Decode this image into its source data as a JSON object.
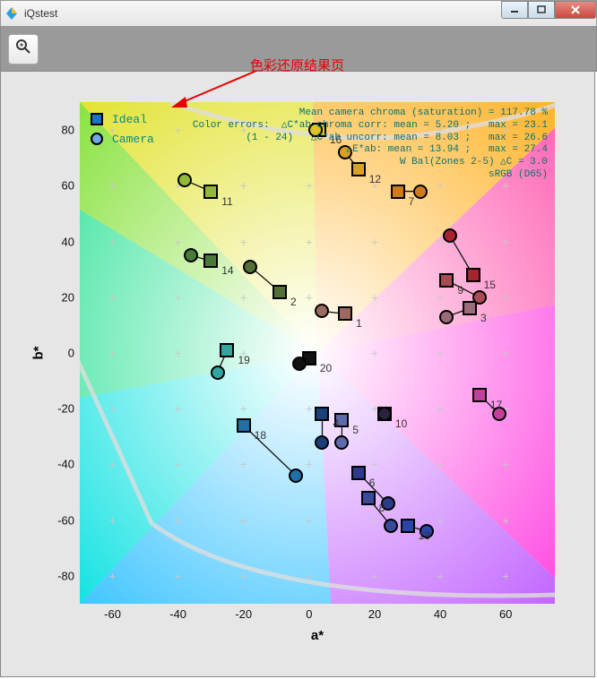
{
  "window": {
    "title": "iQstest"
  },
  "annotation": {
    "text": "色彩还原结果页"
  },
  "legend": {
    "ideal": "Ideal",
    "camera": "Camera"
  },
  "axes": {
    "xlabel": "a*",
    "ylabel": "b*"
  },
  "info_lines": [
    "Mean camera chroma (saturation) = 117.78 %",
    "Color errors:  △C*ab chroma corr: mean = 5.20 ;   max = 23.1",
    "(1 - 24)   △C*ab uncorr: mean = 8.03 ;   max = 26.6",
    "△E*ab: mean = 13.94 ;   max = 27.4",
    "W Bal(Zones 2-5) △C = 3.0",
    "sRGB (D65)"
  ],
  "chart_data": {
    "type": "scatter",
    "xlabel": "a*",
    "ylabel": "b*",
    "xlim": [
      -70,
      75
    ],
    "ylim": [
      -90,
      90
    ],
    "x_ticks": [
      -60,
      -40,
      -20,
      0,
      20,
      40,
      60
    ],
    "y_ticks": [
      -80,
      -60,
      -40,
      -20,
      0,
      20,
      40,
      60,
      80
    ],
    "series": [
      {
        "name": "Ideal",
        "mark": "square"
      },
      {
        "name": "Camera",
        "mark": "circle"
      }
    ],
    "points": [
      {
        "id": "1",
        "color": "#9b6b5f",
        "ideal": {
          "a": 11,
          "b": 14
        },
        "camera": {
          "a": 4,
          "b": 15
        }
      },
      {
        "id": "2",
        "color": "#547038",
        "ideal": {
          "a": -9,
          "b": 22
        },
        "camera": {
          "a": -18,
          "b": 31
        }
      },
      {
        "id": "3",
        "color": "#9a6b78",
        "ideal": {
          "a": 49,
          "b": 16
        },
        "camera": {
          "a": 42,
          "b": 13
        }
      },
      {
        "id": "4",
        "color": "#1b3f7a",
        "ideal": {
          "a": 4,
          "b": -22
        },
        "camera": {
          "a": 4,
          "b": -32
        }
      },
      {
        "id": "5",
        "color": "#5e6aab",
        "ideal": {
          "a": 10,
          "b": -24
        },
        "camera": {
          "a": 10,
          "b": -32
        }
      },
      {
        "id": "6",
        "color": "#2f3a8a",
        "ideal": {
          "a": 15,
          "b": -43
        },
        "camera": {
          "a": 24,
          "b": -54
        }
      },
      {
        "id": "7",
        "color": "#d07a1e",
        "ideal": {
          "a": 27,
          "b": 58
        },
        "camera": {
          "a": 34,
          "b": 58
        }
      },
      {
        "id": "8",
        "color": "#3a4a99",
        "ideal": {
          "a": 18,
          "b": -52
        },
        "camera": {
          "a": 25,
          "b": -62
        }
      },
      {
        "id": "9",
        "color": "#a94a55",
        "ideal": {
          "a": 42,
          "b": 26
        },
        "camera": {
          "a": 52,
          "b": 20
        }
      },
      {
        "id": "10",
        "color": "#2d2140",
        "ideal": {
          "a": 23,
          "b": -22
        },
        "camera": {
          "a": 23,
          "b": -22
        }
      },
      {
        "id": "11",
        "color": "#93b93a",
        "ideal": {
          "a": -30,
          "b": 58
        },
        "camera": {
          "a": -38,
          "b": 62
        }
      },
      {
        "id": "12",
        "color": "#d9a028",
        "ideal": {
          "a": 15,
          "b": 66
        },
        "camera": {
          "a": 11,
          "b": 72
        }
      },
      {
        "id": "13",
        "color": "#2a44a8",
        "ideal": {
          "a": 30,
          "b": -62
        },
        "camera": {
          "a": 36,
          "b": -64
        }
      },
      {
        "id": "14",
        "color": "#4a7a39",
        "ideal": {
          "a": -30,
          "b": 33
        },
        "camera": {
          "a": -36,
          "b": 35
        }
      },
      {
        "id": "15",
        "color": "#a6242e",
        "ideal": {
          "a": 50,
          "b": 28
        },
        "camera": {
          "a": 43,
          "b": 42
        }
      },
      {
        "id": "16",
        "color": "#ddc22a",
        "ideal": {
          "a": 3,
          "b": 80
        },
        "camera": {
          "a": 2,
          "b": 80
        }
      },
      {
        "id": "17",
        "color": "#c33f9a",
        "ideal": {
          "a": 52,
          "b": -15
        },
        "camera": {
          "a": 58,
          "b": -22
        }
      },
      {
        "id": "18",
        "color": "#1f70a8",
        "ideal": {
          "a": -20,
          "b": -26
        },
        "camera": {
          "a": -4,
          "b": -44
        }
      },
      {
        "id": "19",
        "color": "#32a5a1",
        "ideal": {
          "a": -25,
          "b": 1
        },
        "camera": {
          "a": -28,
          "b": -7
        }
      },
      {
        "id": "20",
        "color": "#111111",
        "ideal": {
          "a": 0,
          "b": -2
        },
        "camera": {
          "a": -3,
          "b": -4
        }
      }
    ]
  }
}
